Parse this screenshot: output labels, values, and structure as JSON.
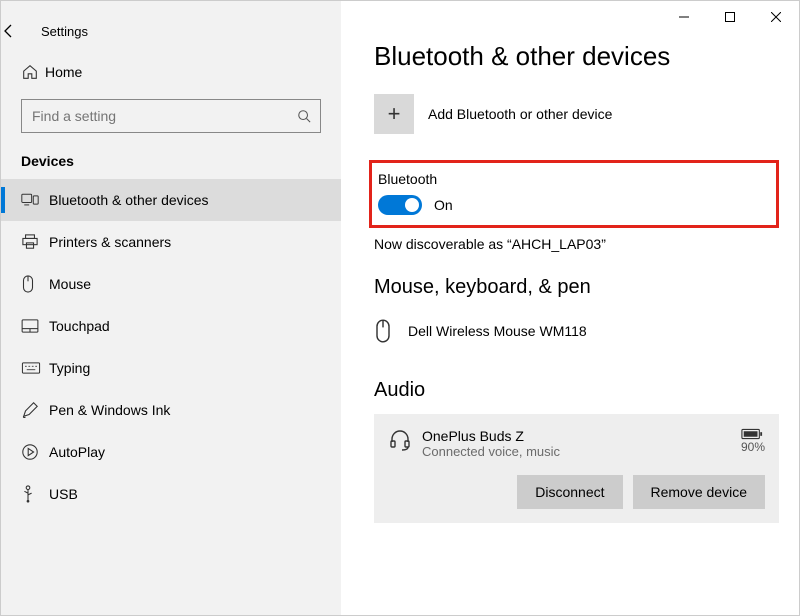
{
  "window": {
    "title": "Settings"
  },
  "home": {
    "label": "Home"
  },
  "search": {
    "placeholder": "Find a setting"
  },
  "section_label": "Devices",
  "nav": [
    {
      "label": "Bluetooth & other devices",
      "selected": true
    },
    {
      "label": "Printers & scanners"
    },
    {
      "label": "Mouse"
    },
    {
      "label": "Touchpad"
    },
    {
      "label": "Typing"
    },
    {
      "label": "Pen & Windows Ink"
    },
    {
      "label": "AutoPlay"
    },
    {
      "label": "USB"
    }
  ],
  "page": {
    "title": "Bluetooth & other devices",
    "add_label": "Add Bluetooth or other device",
    "bluetooth_label": "Bluetooth",
    "toggle_state": "On",
    "discoverable": "Now discoverable as “AHCH_LAP03”",
    "section_mouse": "Mouse, keyboard, & pen",
    "device_mouse": "Dell Wireless Mouse WM118",
    "section_audio": "Audio",
    "audio_device": {
      "name": "OnePlus Buds Z",
      "status": "Connected voice, music",
      "battery": "90%"
    },
    "actions": {
      "disconnect": "Disconnect",
      "remove": "Remove device"
    }
  }
}
